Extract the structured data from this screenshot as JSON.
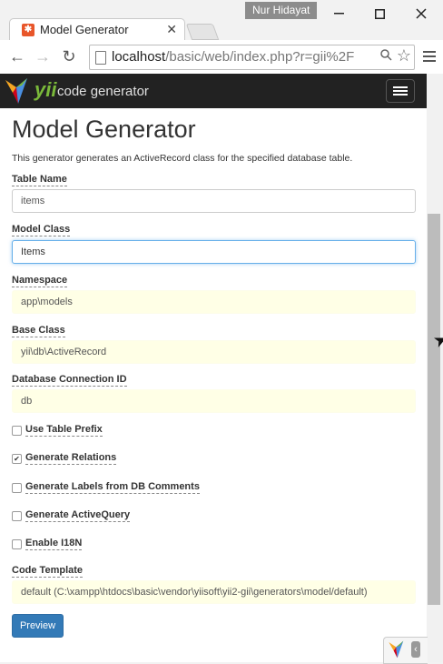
{
  "window": {
    "user": "Nur Hidayat",
    "tab_title": "Model Generator",
    "controls": [
      "minimize",
      "maximize",
      "close"
    ]
  },
  "toolbar": {
    "url_host": "localhost",
    "url_path": "/basic/web/index.php?r=gii%2F"
  },
  "navbar": {
    "brand_yii": "yii",
    "brand_text": "code generator"
  },
  "page": {
    "title": "Model Generator",
    "description": "This generator generates an ActiveRecord class for the specified database table."
  },
  "form": {
    "table_name": {
      "label": "Table Name",
      "value": "items"
    },
    "model_class": {
      "label": "Model Class",
      "value": "Items"
    },
    "namespace": {
      "label": "Namespace",
      "value": "app\\models"
    },
    "base_class": {
      "label": "Base Class",
      "value": "yii\\db\\ActiveRecord"
    },
    "db_connection": {
      "label": "Database Connection ID",
      "value": "db"
    },
    "checkboxes": [
      {
        "label": "Use Table Prefix",
        "checked": false
      },
      {
        "label": "Generate Relations",
        "checked": true
      },
      {
        "label": "Generate Labels from DB Comments",
        "checked": false
      },
      {
        "label": "Generate ActiveQuery",
        "checked": false
      },
      {
        "label": "Enable I18N",
        "checked": false
      }
    ],
    "code_template": {
      "label": "Code Template",
      "value": "default (C:\\xampp\\htdocs\\basic\\vendor\\yiisoft\\yii2-gii\\generators\\model/default)"
    },
    "preview_label": "Preview"
  },
  "colors": {
    "accent": "#337ab7",
    "sticky_bg": "#ffffe6",
    "navbar_bg": "#222222",
    "brand_green": "#7ab93a"
  }
}
